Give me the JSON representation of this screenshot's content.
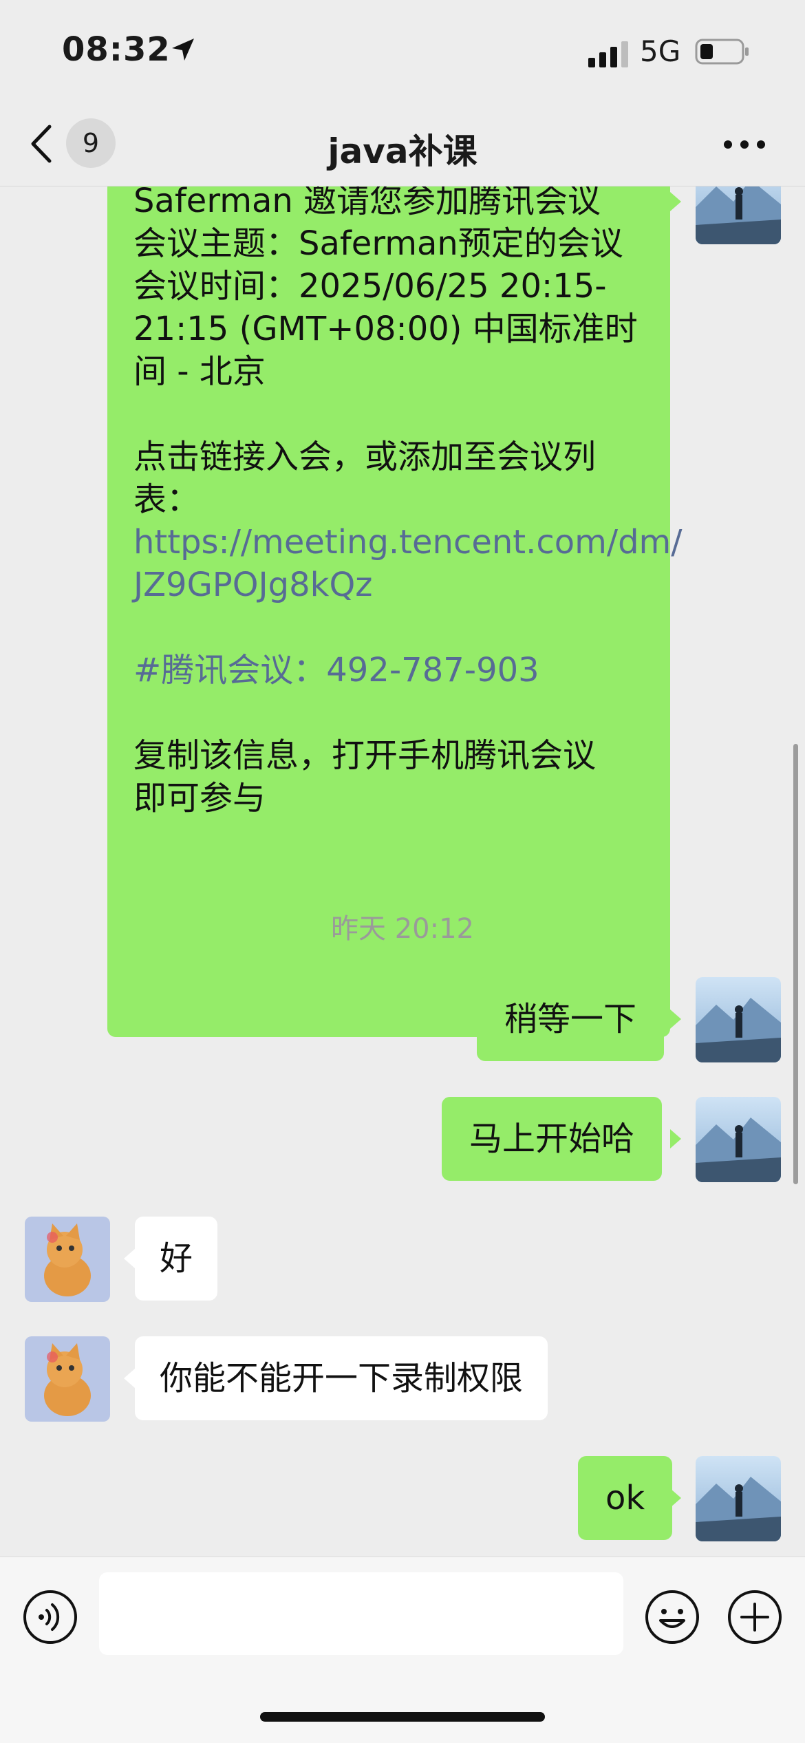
{
  "status_bar": {
    "time": "08:32",
    "network": "5G"
  },
  "nav": {
    "unread_count": "9",
    "title": "java补课"
  },
  "messages": {
    "invite": {
      "lines": [
        "Saferman 邀请您参加腾讯会议",
        "会议主题：Saferman预定的会议",
        "会议时间：2025/06/25 20:15-",
        "21:15 (GMT+08:00) 中国标准时",
        "间 - 北京",
        "",
        "点击链接入会，或添加至会议列",
        "表：",
        "https://meeting.tencent.com/dm/",
        "JZ9GPOJg8kQz",
        "",
        "#腾讯会议：492-787-903",
        "",
        "复制该信息，打开手机腾讯会议",
        "即可参与"
      ]
    },
    "timestamp": "昨天 20:12",
    "m1": "稍等一下",
    "m2": "马上开始哈",
    "m3": "好",
    "m4": "你能不能开一下录制权限",
    "m5": "ok"
  },
  "colors": {
    "outgoing_bubble": "#95ec69",
    "incoming_bubble": "#ffffff",
    "link": "#576b95",
    "background": "#ededed"
  },
  "icons": [
    "location-arrow-icon",
    "signal-icon",
    "battery-icon",
    "back-chevron-icon",
    "more-icon",
    "voice-icon",
    "emoji-icon",
    "plus-icon"
  ]
}
